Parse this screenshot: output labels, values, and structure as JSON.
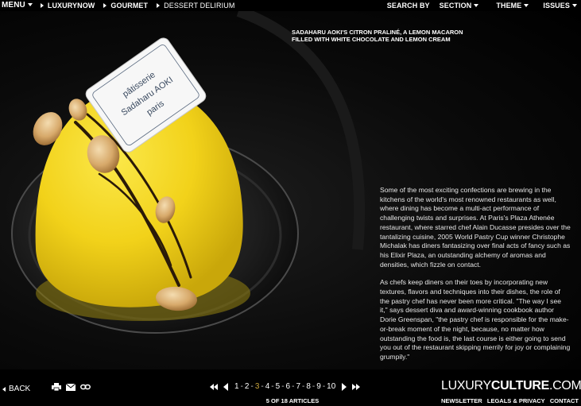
{
  "nav": {
    "menu_label": "MENU",
    "breadcrumbs": [
      "LUXURYNOW",
      "GOURMET",
      "DESSERT DELIRIUM"
    ],
    "search_by": "SEARCH BY",
    "section": "SECTION",
    "theme": "THEME",
    "issues": "ISSUES"
  },
  "caption": "SADAHARU AOKI'S CITRON PRALINÉ, A LEMON MACARON FILLED WITH WHITE CHOCOLATE AND LEMON CREAM",
  "plaque": {
    "line1": "pâtisserie",
    "line2": "Sadaharu AOKI",
    "line3": "paris"
  },
  "article": {
    "p1": "Some of the most exciting confections are brewing in the kitchens of the world's most renowned restaurants as well, where dining has become a multi-act performance of challenging twists and surprises. At Paris's Plaza Athenée restaurant, where starred chef Alain Ducasse presides over the tantalizing cuisine, 2005 World Pastry Cup winner Christophe Michalak has diners fantasizing over final acts of fancy such as his Elixir Plaza, an outstanding alchemy of aromas and densities, which fizzle on contact.",
    "p2": "As chefs keep diners on their toes by incorporating new textures, flavors and techniques into their dishes, the role of the pastry chef has never been more critical. \"The way I see it,\" says dessert diva and award-winning cookbook author Dorie Greenspan, \"the pastry chef is responsible for the make-or-break moment of the night, because, no matter how outstanding the food is, the last course is either going to send you out of the restaurant skipping merrily for joy or complaining grumpily.\""
  },
  "footer": {
    "back_label": "BACK",
    "pages": [
      "1",
      "2",
      "3",
      "4",
      "5",
      "6",
      "7",
      "8",
      "9",
      "10"
    ],
    "active_page": "3",
    "article_count": "5 OF 18 ARTICLES",
    "logo_light": "LUXURY",
    "logo_bold": "CULTURE",
    "logo_domain": ".COM",
    "links": [
      "NEWSLETTER",
      "LEGALS & PRIVACY",
      "CONTACT"
    ]
  },
  "colors": {
    "accent": "#c8a43c",
    "cake": "#f2d21a",
    "background": "#000000"
  }
}
